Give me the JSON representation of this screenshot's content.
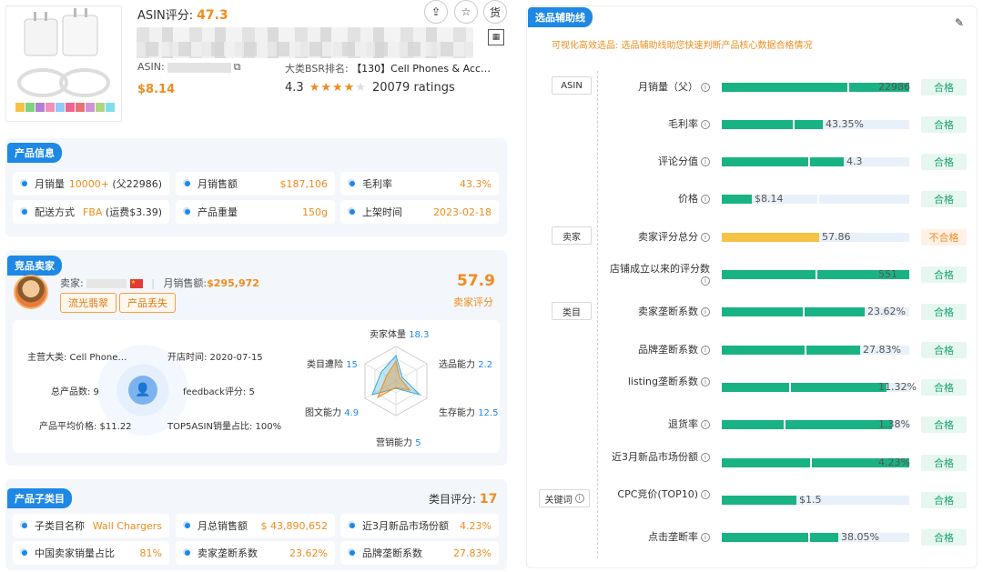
{
  "header": {
    "asin_score_label": "ASIN评分:",
    "asin_score_value": "47.3",
    "asin_label": "ASIN:",
    "bsr_label": "大类BSR排名:",
    "bsr_value": "【130】Cell Phones & Acc…",
    "price": "$8.14",
    "rating": "4.3",
    "ratings_count": "20079 ratings",
    "buttons": {
      "share": "⇪",
      "favorite": "☆",
      "goods": "货"
    }
  },
  "product_info": {
    "tag": "产品信息",
    "cells": [
      {
        "label": "月销量",
        "value": "10000+",
        "extra": "(父22986)"
      },
      {
        "label": "月销售额",
        "value": "$187,106",
        "extra": ""
      },
      {
        "label": "毛利率",
        "value": "43.3%",
        "extra": ""
      },
      {
        "label": "配送方式",
        "value": "FBA",
        "extra": "(运费$3.39)"
      },
      {
        "label": "产品重量",
        "value": "150g",
        "extra": ""
      },
      {
        "label": "上架时间",
        "value": "2023-02-18",
        "extra": ""
      }
    ]
  },
  "seller": {
    "tag": "竞品卖家",
    "seller_label": "卖家:",
    "monthly_sales_label": "月销售额:",
    "monthly_sales_value": "$295,972",
    "pill1": "流光翡翠",
    "pill2": "产品丢失",
    "score": "57.9",
    "score_label": "卖家评分",
    "stats": {
      "main_category": "主营大类: Cell Phone…",
      "open_time": "开店时间: 2020-07-15",
      "total_products": "总产品数: 9",
      "feedback": "feedback评分: 5",
      "avg_price": "产品平均价格: $11.22",
      "top5": "TOP5ASIN销量占比: 100%"
    },
    "radar": [
      {
        "label": "卖家体量",
        "value": "18.3"
      },
      {
        "label": "选品能力",
        "value": "2.2"
      },
      {
        "label": "生存能力",
        "value": "12.5"
      },
      {
        "label": "营销能力",
        "value": "5"
      },
      {
        "label": "图文能力",
        "value": "4.9"
      },
      {
        "label": "类目遭险",
        "value": "15"
      }
    ]
  },
  "subcategory": {
    "tag": "产品子类目",
    "score_label": "类目评分:",
    "score_value": "17",
    "cells": [
      {
        "label": "子类目名称",
        "value": "Wall Chargers"
      },
      {
        "label": "月总销售额",
        "value": "$ 43,890,652"
      },
      {
        "label": "近3月新品市场份额",
        "value": "4.23%"
      },
      {
        "label": "中国卖家销量占比",
        "value": "81%"
      },
      {
        "label": "卖家垄断系数",
        "value": "23.62%"
      },
      {
        "label": "品牌垄断系数",
        "value": "27.83%"
      }
    ]
  },
  "assist": {
    "tag": "选品辅助线",
    "subtitle": "可视化高效选品: 选品辅助线助您快速判断产品核心数据合格情况",
    "groups": [
      "ASIN",
      "卖家",
      "类目",
      "关键词"
    ],
    "ok_label": "合格",
    "bad_label": "不合格",
    "metrics": [
      {
        "label": "月销量（父）",
        "value": "22986",
        "fill": 1.0,
        "tick": 0.67,
        "status": "合格"
      },
      {
        "label": "毛利率",
        "value": "43.35%",
        "fill": 0.54,
        "tick": 0.38,
        "status": "合格"
      },
      {
        "label": "评论分值",
        "value": "4.3",
        "fill": 0.65,
        "tick": 0.46,
        "status": "合格"
      },
      {
        "label": "价格",
        "value": "$8.14",
        "fill": 0.16,
        "tick": 0.51,
        "status": "合格"
      },
      {
        "label": "卖家评分总分",
        "value": "57.86",
        "fill": 0.52,
        "tick": -1,
        "status": "不合格"
      },
      {
        "label": "店铺成立以来的评分数",
        "value": "551",
        "fill": 1.0,
        "tick": 0.5,
        "status": "合格"
      },
      {
        "label": "卖家垄断系数",
        "value": "23.62%",
        "fill": 0.76,
        "tick": 0.43,
        "status": "合格"
      },
      {
        "label": "品牌垄断系数",
        "value": "27.83%",
        "fill": 0.74,
        "tick": 0.44,
        "status": "合格"
      },
      {
        "label": "listing垄断系数",
        "value": "11.32%",
        "fill": 0.88,
        "tick": 0.36,
        "status": "合格"
      },
      {
        "label": "退货率",
        "value": "1.38%",
        "fill": 0.91,
        "tick": 0.33,
        "status": "合格"
      },
      {
        "label": "近3月新品市场份额",
        "value": "4.23%",
        "fill": 1.0,
        "tick": 0.47,
        "status": "合格"
      },
      {
        "label": "CPC竞价(TOP10)",
        "value": "$1.5",
        "fill": 0.4,
        "tick": -1,
        "status": "合格"
      },
      {
        "label": "点击垄断率",
        "value": "38.05%",
        "fill": 0.62,
        "tick": 0.46,
        "status": "合格"
      }
    ]
  }
}
